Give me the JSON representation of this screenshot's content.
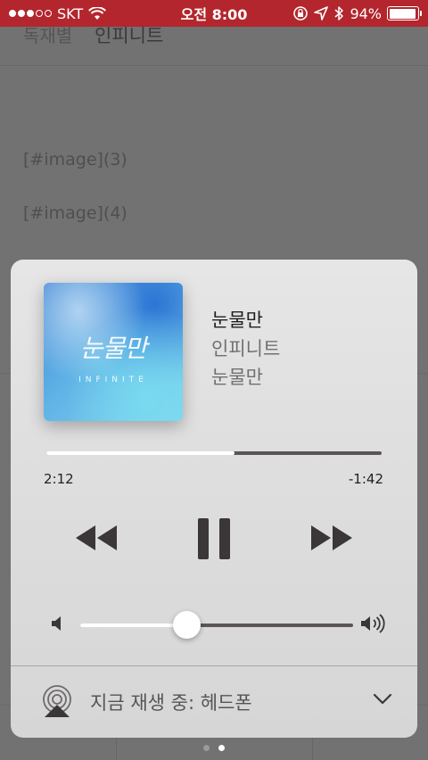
{
  "status_bar": {
    "carrier": "SKT",
    "time": "오전 8:00",
    "battery_text": "94%",
    "battery_level": 0.94,
    "signal_bars_filled": 3,
    "signal_bars_total": 5
  },
  "background_app": {
    "back_label": "독재별",
    "title": "인피니트",
    "lines": [
      "[#image](3)",
      "[#image](4)"
    ]
  },
  "now_playing": {
    "title": "눈물만",
    "artist": "인피니트",
    "album": "눈물만",
    "album_art_text": "눈물만",
    "album_art_subtext": "INFINITE",
    "elapsed": "2:12",
    "remaining": "-1:42",
    "progress": 0.56,
    "volume": 0.39
  },
  "airplay": {
    "label": "지금 재생 중: 헤드폰"
  },
  "pager": {
    "pages": 2,
    "active": 1
  },
  "colors": {
    "status_bar": "#b3262d",
    "panel": "#e2e2e2",
    "track_unfilled": "#5b5558",
    "controls": "#3b3638"
  }
}
